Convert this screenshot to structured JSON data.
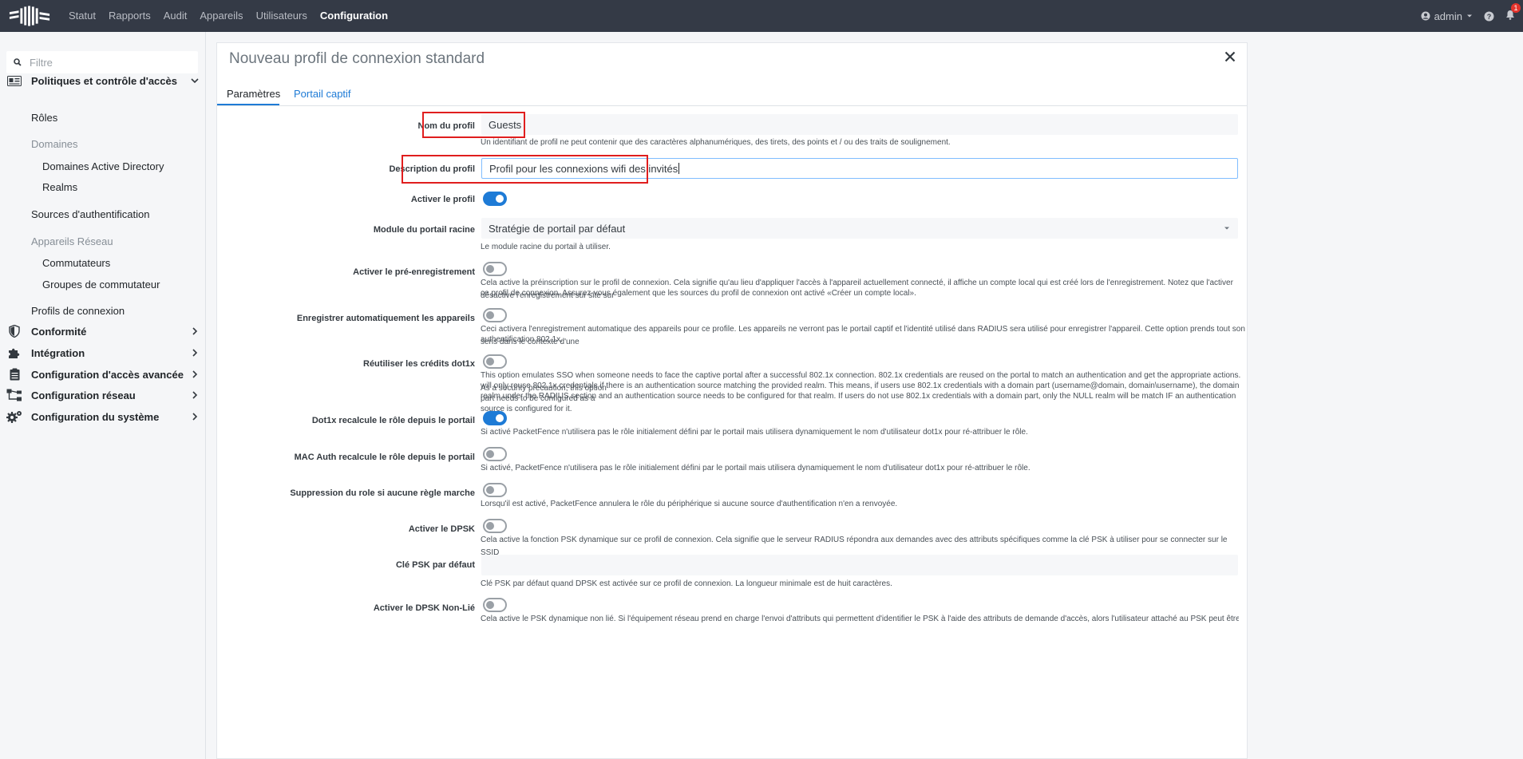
{
  "topbar": {
    "nav": [
      "Statut",
      "Rapports",
      "Audit",
      "Appareils",
      "Utilisateurs",
      "Configuration"
    ],
    "active": "Configuration",
    "user": "admin",
    "notification_count": "1"
  },
  "sidebar": {
    "filter_placeholder": "Filtre",
    "group_policies": "Politiques et contrôle d'accès",
    "roles": "Rôles",
    "domains": "Domaines",
    "ad_domains": "Domaines Active Directory",
    "realms": "Realms",
    "auth_sources": "Sources d'authentification",
    "network_devices": "Appareils Réseau",
    "switches": "Commutateurs",
    "switch_groups": "Groupes de commutateur",
    "connection_profiles": "Profils de connexion",
    "group_compliance": "Conformité",
    "group_integration": "Intégration",
    "group_advanced": "Configuration d'accès avancée",
    "group_network": "Configuration réseau",
    "group_system": "Configuration du système"
  },
  "panel": {
    "title": "Nouveau profil de connexion standard",
    "tabs": [
      "Paramètres",
      "Portail captif"
    ]
  },
  "form": {
    "name_label": "Nom du profil",
    "name_value": "Guests",
    "name_help": "Un identifiant de profil ne peut contenir que des caractères alphanumériques, des tirets, des points et / ou des traits de soulignement.",
    "desc_label": "Description du profil",
    "desc_value": "Profil pour les connexions wifi des invités",
    "enable_label": "Activer le profil",
    "root_module_label": "Module du portail racine",
    "root_module_value": "Stratégie de portail par défaut",
    "root_module_help": "Le module racine du portail à utiliser.",
    "preregistration_label": "Activer le pré-enregistrement",
    "preregistration_help_1": "Cela active la préinscription sur le profil de connexion. Cela signifie qu'au lieu d'appliquer l'accès à l'appareil actuellement connecté, il affiche un compte local qui est créé lors de l'enregistrement. Notez que l'activer désactive l'enregistrement sur site sur",
    "preregistration_help_2": "ce profil de connexion. Assurez-vous également que les sources du profil de connexion ont activé «Créer un compte local».",
    "autoreg_label": "Enregistrer automatiquement les appareils",
    "autoreg_help_1": "Ceci activera l'enregistrement automatique des appareils pour ce profile. Les appareils ne verront pas le portail captif et l'identité utilisé dans RADIUS sera utilisé pour enregistrer l'appareil. Cette option prends tout son sens dans le contexte d'une",
    "autoreg_help_2": "authentification 802.1x.",
    "reuse_label": "Réutiliser les crédits dot1x",
    "reuse_help_1": "This option emulates SSO when someone needs to face the captive portal after a successful 802.1x connection. 802.1x credentials are reused on the portal to match an authentication and get the appropriate actions. As a security precaution, this option",
    "reuse_help_2": "will only reuse 802.1x credentials if there is an authentication source matching the provided realm. This means, if users use 802.1x credentials with a domain part (username@domain, domain\\username), the domain part needs to be configured as a",
    "reuse_help_3": "realm under the RADIUS section and an authentication source needs to be configured for that realm. If users do not use 802.1x credentials with a domain part, only the NULL realm will be match IF an authentication source is configured for it.",
    "dot1x_recompute_label": "Dot1x recalcule le rôle depuis le portail",
    "dot1x_recompute_help": "Si activé PacketFence n'utilisera pas le rôle initialement défini par le portail mais utilisera dynamiquement le nom d'utilisateur dot1x pour ré-attribuer le rôle.",
    "mac_recompute_label": "MAC Auth recalcule le rôle depuis le portail",
    "mac_recompute_help": "Si activé, PacketFence n'utilisera pas le rôle initialement défini par le portail mais utilisera dynamiquement le nom d'utilisateur dot1x pour ré-attribuer le rôle.",
    "unset_role_label": "Suppression du role si aucune règle marche",
    "unset_role_help": "Lorsqu'il est activé, PacketFence annulera le rôle du périphérique si aucune source d'authentification n'en a renvoyée.",
    "dpsk_label": "Activer le DPSK",
    "dpsk_help": "Cela active la fonction PSK dynamique sur ce profil de connexion. Cela signifie que le serveur RADIUS répondra aux demandes avec des attributs spécifiques comme la clé PSK à utiliser pour se connecter sur le SSID",
    "psk_label": "Clé PSK par défaut",
    "psk_help": "Clé PSK par défaut quand DPSK est activée sur ce profil de connexion. La longueur minimale est de huit caractères.",
    "dpsk_unbound_label": "Activer le DPSK Non-Lié",
    "dpsk_unbound_help": "Cela active le PSK dynamique non lié. Si l'équipement réseau prend en charge l'envoi d'attributs qui permettent d'identifier le PSK à l'aide des attributs de demande d'accès, alors l'utilisateur attaché au PSK peut être trouvé et utilisé de la même manière"
  }
}
